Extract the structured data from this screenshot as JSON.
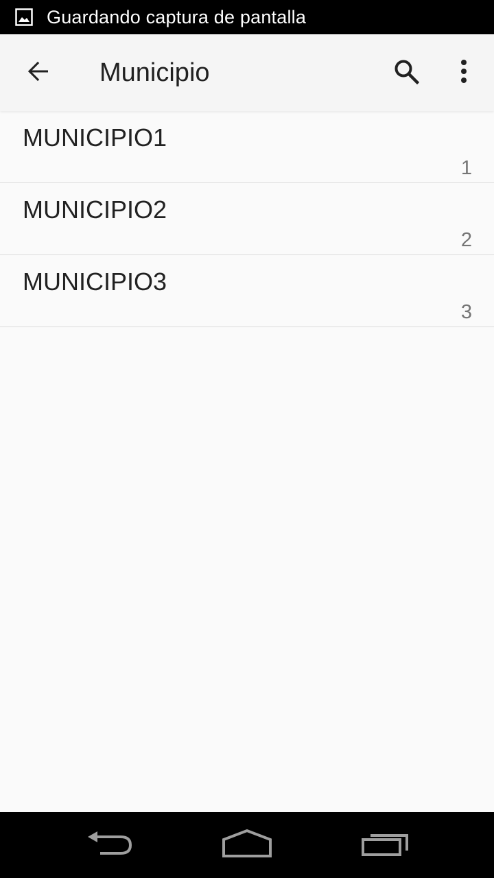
{
  "status_bar": {
    "notification_icon": "image-icon",
    "text": "Guardando captura de pantalla"
  },
  "app_bar": {
    "back_icon": "arrow-back-icon",
    "title": "Municipio",
    "search_icon": "search-icon",
    "overflow_icon": "more-vert-icon"
  },
  "list": {
    "items": [
      {
        "name": "MUNICIPIO1",
        "code": "1"
      },
      {
        "name": "MUNICIPIO2",
        "code": "2"
      },
      {
        "name": "MUNICIPIO3",
        "code": "3"
      }
    ]
  },
  "nav_bar": {
    "back_icon": "nav-back-icon",
    "home_icon": "nav-home-icon",
    "recents_icon": "nav-recents-icon"
  },
  "colors": {
    "status_bar_bg": "#000000",
    "app_bar_bg": "#f5f5f5",
    "background": "#fafafa",
    "primary_text": "#212121",
    "secondary_text": "#757575",
    "divider": "#dcdcdc",
    "nav_icon": "#9e9e9e"
  }
}
